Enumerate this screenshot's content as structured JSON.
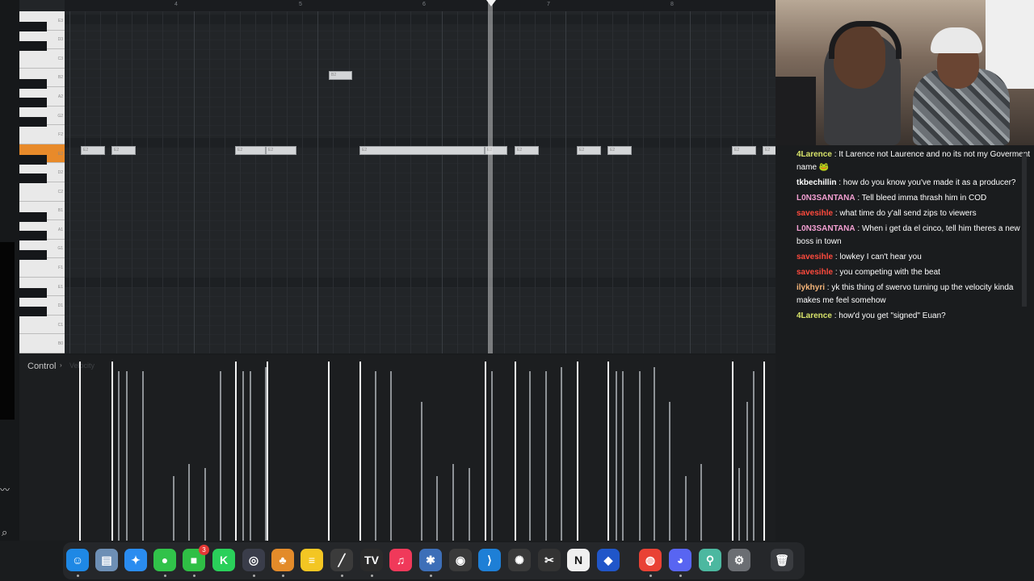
{
  "piano_roll": {
    "ruler_numbers": [
      "4",
      "5",
      "6",
      "7",
      "8"
    ],
    "key_labels": [
      "E3",
      "D3",
      "C3",
      "B2",
      "A2",
      "G2",
      "F2",
      "E2",
      "D2",
      "C2",
      "B1",
      "A1",
      "G1",
      "F1",
      "E1",
      "D1",
      "C1",
      "B0"
    ],
    "highlighted_key": "E2",
    "notes_label": "E2",
    "high_note_label": "B2",
    "velocity_dim": "Velocity"
  },
  "control": {
    "label": "Control",
    "arrow": "›"
  },
  "chat": [
    {
      "user": "4Larence",
      "color": "#d8e36a",
      "text": "It Larence not Laurence and no its not my Goverment name",
      "emoji": "🐸"
    },
    {
      "user": "tkbechillin",
      "color": "#ffffff",
      "text": "how do you know you've made it as a producer?"
    },
    {
      "user": "L0N3SANTANA",
      "color": "#f39fd2",
      "text": "Tell bleed imma thrash him in COD"
    },
    {
      "user": "savesihle",
      "color": "#ff4a3d",
      "text": "what time do y'all send zips to viewers"
    },
    {
      "user": "L0N3SANTANA",
      "color": "#f39fd2",
      "text": "When i get da el cinco, tell him theres a new boss in town"
    },
    {
      "user": "savesihle",
      "color": "#ff4a3d",
      "text": "lowkey I can't hear you"
    },
    {
      "user": "savesihle",
      "color": "#ff4a3d",
      "text": "you competing with the beat"
    },
    {
      "user": "ilykhyri",
      "color": "#f7b67a",
      "text": "yk this thing of swervo turning up the velocity kinda makes me feel somehow"
    },
    {
      "user": "4Larence",
      "color": "#d8e36a",
      "text": "how'd you get \"signed\" Euan?"
    }
  ],
  "dock": {
    "apps": [
      {
        "name": "finder-icon",
        "glyph": "☺",
        "color": "#1e88e5"
      },
      {
        "name": "files-icon",
        "glyph": "▤",
        "color": "#6d8fb5"
      },
      {
        "name": "safari-icon",
        "glyph": "✦",
        "color": "#2a8cf0"
      },
      {
        "name": "messages-icon",
        "glyph": "●",
        "color": "#31c24a"
      },
      {
        "name": "facetime-icon",
        "glyph": "■",
        "color": "#2fbf45",
        "badge": "3"
      },
      {
        "name": "kick-icon",
        "glyph": "K",
        "color": "#2ad05a"
      },
      {
        "name": "obs-icon",
        "glyph": "◎",
        "color": "#3a3d4a"
      },
      {
        "name": "fl-studio-icon",
        "glyph": "♣",
        "color": "#e38b2a"
      },
      {
        "name": "notes-icon",
        "glyph": "≡",
        "color": "#f3c623"
      },
      {
        "name": "pen-icon",
        "glyph": "╱",
        "color": "#3b3b3b"
      },
      {
        "name": "tradingview-icon",
        "glyph": "TV",
        "color": "#2b2b2b"
      },
      {
        "name": "music-icon",
        "glyph": "♫",
        "color": "#f0395a"
      },
      {
        "name": "davinci-icon",
        "glyph": "✱",
        "color": "#3d6fb8"
      },
      {
        "name": "github-icon",
        "glyph": "◉",
        "color": "#3a3a3a"
      },
      {
        "name": "vscode-icon",
        "glyph": "⟩",
        "color": "#1e7fd6"
      },
      {
        "name": "chatgpt-icon",
        "glyph": "✺",
        "color": "#3a3a3a"
      },
      {
        "name": "capcut-icon",
        "glyph": "✂",
        "color": "#333"
      },
      {
        "name": "notion-icon",
        "glyph": "N",
        "color": "#f0f0f0"
      },
      {
        "name": "virtualbox-icon",
        "glyph": "◆",
        "color": "#2056c9"
      },
      {
        "name": "chrome-icon",
        "glyph": "◍",
        "color": "#e94235"
      },
      {
        "name": "discord-icon",
        "glyph": "◕",
        "color": "#5865f2"
      },
      {
        "name": "keys-icon",
        "glyph": "⚲",
        "color": "#4cb8a0"
      },
      {
        "name": "settings-icon",
        "glyph": "⚙",
        "color": "#6b6e73"
      },
      {
        "name": "trash-icon",
        "glyph": "🗑",
        "color": "#3a3c40"
      }
    ]
  }
}
